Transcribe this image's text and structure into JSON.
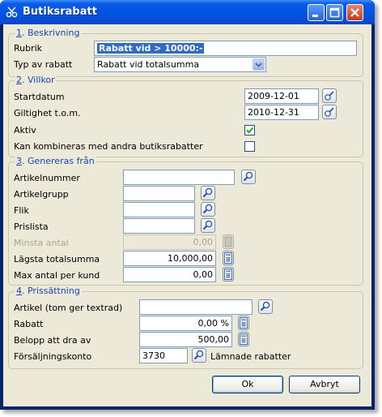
{
  "window": {
    "title": "Butiksrabatt"
  },
  "section1": {
    "title": "1. Beskrivning",
    "rubrik": {
      "label": "Rubrik",
      "value": "Rabatt vid > 10000:-"
    },
    "typ": {
      "label": "Typ av rabatt",
      "value": "Rabatt vid totalsumma"
    }
  },
  "section2": {
    "title": "2. Villkor",
    "startdatum": {
      "label": "Startdatum",
      "value": "2009-12-01"
    },
    "giltighet": {
      "label": "Giltighet t.o.m.",
      "value": "2010-12-31"
    },
    "aktiv": {
      "label": "Aktiv",
      "checked": true
    },
    "kombineras": {
      "label": "Kan kombineras med andra butiksrabatter",
      "checked": false
    }
  },
  "section3": {
    "title": "3. Genereras från",
    "artikelnummer": {
      "label": "Artikelnummer",
      "value": ""
    },
    "artikelgrupp": {
      "label": "Artikelgrupp",
      "value": ""
    },
    "flik": {
      "label": "Flik",
      "value": ""
    },
    "prislista": {
      "label": "Prislista",
      "value": ""
    },
    "minsta_antal": {
      "label": "Minsta antal",
      "value": "0,00",
      "disabled": true
    },
    "lagsta_totalsumma": {
      "label": "Lägsta totalsumma",
      "value": "10,000,00"
    },
    "max_antal": {
      "label": "Max antal per kund",
      "value": "0,00"
    }
  },
  "section4": {
    "title": "4. Prissättning",
    "artikel": {
      "label": "Artikel (tom ger textrad)",
      "value": ""
    },
    "rabatt": {
      "label": "Rabatt",
      "value": "0,00 %"
    },
    "belopp": {
      "label": "Belopp att dra av",
      "value": "500,00"
    },
    "konto": {
      "label": "Försäljningskonto",
      "value": "3730",
      "description": "Lämnade rabatter"
    }
  },
  "buttons": {
    "ok": "Ok",
    "cancel": "Avbryt"
  },
  "colors": {
    "titlebar": "#0054e3",
    "dialog_bg": "#ece9d8",
    "group_title": "#1747b5",
    "selection": "#316ac5"
  }
}
